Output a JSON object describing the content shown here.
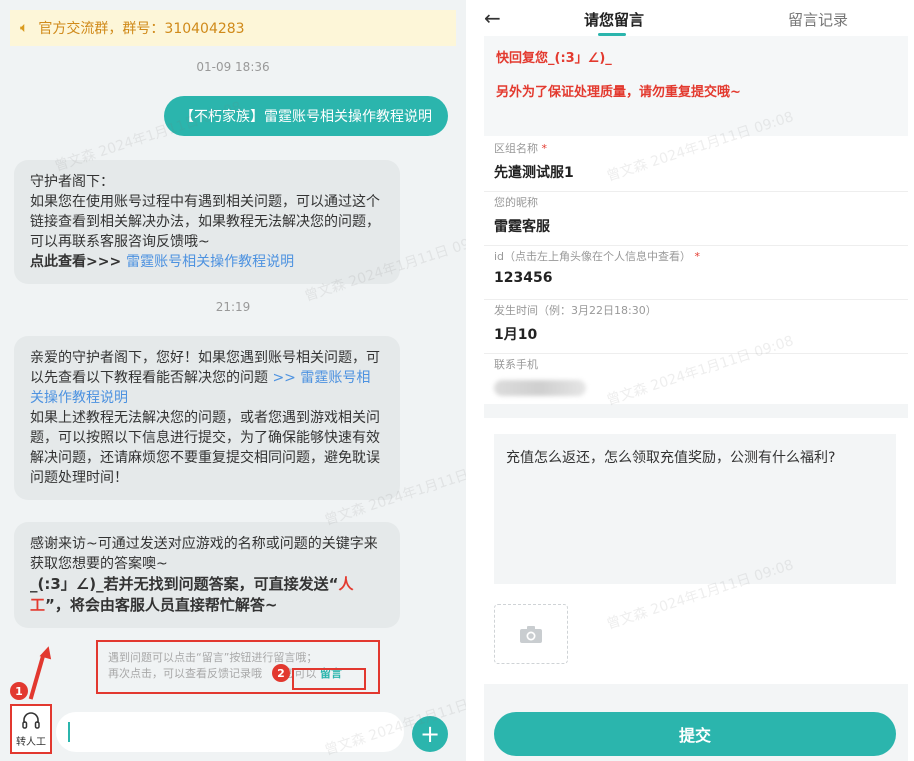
{
  "left": {
    "notice": "官方交流群，群号：310404283",
    "time1": "01-09 18:36",
    "sent_message": "【不朽家族】雷霆账号相关操作教程说明",
    "bubble1": {
      "line1": "守护者阁下：",
      "body": "如果您在使用账号过程中有遇到相关问题，可以通过这个链接查看到相关解决办法，如果教程无法解决您的问题，可以再联系客服咨询反馈哦~",
      "cta": "点此查看>>> ",
      "link": "雷霆账号相关操作教程说明"
    },
    "time2": "21:19",
    "bubble2": {
      "text1": "亲爱的守护者阁下，您好！如果您遇到账号相关问题，可以先查看以下教程看能否解决您的问题 ",
      "link": ">> 雷霆账号相关操作教程说明",
      "text2": "如果上述教程无法解决您的问题，或者您遇到游戏相关问题，可以按照以下信息进行提交，为了确保能够快速有效解决问题，还请麻烦您不要重复提交相同问题，避免耽误问题处理时间！"
    },
    "bubble3": {
      "text1": "感谢来访~可通过发送对应游戏的名称或问题的关键字来获取您想要的答案噢~",
      "bold1": "_(:3」∠)_若并无找到问题答案，可直接发送“",
      "red": "人工",
      "bold2": "”，将会由客服人员直接帮忙解答~"
    },
    "hint": {
      "line1": "遇到问题可以点击“留言”按钮进行留言哦；",
      "line2": "再次点击，可以查看反馈记录哦 ",
      "line2b": "您可以 ",
      "link": "留言"
    },
    "badge1": "1",
    "badge2": "2",
    "agent_label": "转人工",
    "plus": "+"
  },
  "right": {
    "back": "←",
    "tab_active": "请您留言",
    "tab_inactive": "留言记录",
    "notice_line1": "快回复您_(:3」∠)_",
    "notice_line2": "另外为了保证处理质量，请勿重复提交哦~",
    "fields": [
      {
        "label": "区组名称",
        "required": "*",
        "value": "先遣测试服1"
      },
      {
        "label": "您的昵称",
        "required": "",
        "value": "雷霆客服"
      },
      {
        "label": "id（点击左上角头像在个人信息中查看）",
        "required": "*",
        "value": "123456"
      },
      {
        "label": "发生时间（例：3月22日18:30）",
        "required": "",
        "value": "1月10"
      },
      {
        "label": "联系手机",
        "required": "",
        "value": ""
      }
    ],
    "question": "充值怎么返还，怎么领取充值奖励，公测有什么福利?",
    "submit": "提交"
  },
  "watermark": "曾文森 2024年1月11日 09:08",
  "colors": {
    "accent": "#2bb5ad",
    "alert": "#e2382f",
    "link": "#4d92e0"
  }
}
